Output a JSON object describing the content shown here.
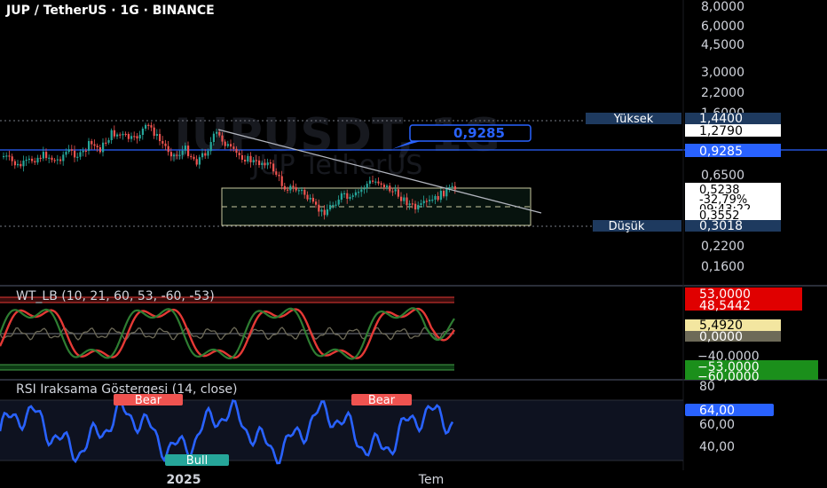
{
  "header": {
    "symbol_title": "JUP / TetherUS · 1G · BINANCE"
  },
  "watermark": {
    "ticker": "JUPUSDT, 1G",
    "name": "JUP TetherUS"
  },
  "colors": {
    "up": "#26a69a",
    "down": "#ef5350",
    "blue": "#2962ff",
    "rsi": "#2962ff",
    "bg": "#000000"
  },
  "price_pane": {
    "scale": "log",
    "axis_labels": [
      "8,0000",
      "6,0000",
      "4,5000",
      "3,0000",
      "2,2000",
      "1,6000",
      "0,6500",
      "0,2200",
      "0,1600"
    ],
    "axis_values": [
      8.0,
      6.0,
      4.5,
      3.0,
      2.2,
      1.6,
      0.65,
      0.22,
      0.16
    ],
    "high_label": "Yüksek",
    "high_value": "1,4400",
    "current_upper": "1,2790",
    "annotation_price": "0,9285",
    "price_close": "0,5238",
    "change_pct": "-32,79%",
    "countdown": "09:43:22",
    "price_lower": "0,3552",
    "low_label": "Düşük",
    "low_value": "0,3018"
  },
  "wt_pane": {
    "title": "WT_LB (10, 21, 60, 53, -60, -53)",
    "labels": {
      "ob1": "53,0000",
      "wt1": "48,5442",
      "diff": "5,4920",
      "zero": "0,0000",
      "neg40": "−40,0000",
      "os1": "−53,0000",
      "os2": "−60,0000"
    }
  },
  "rsi_pane": {
    "title": "RSI Iraksama Göstergesi (14, close)",
    "axis_labels": [
      "80",
      "60,00",
      "40,00"
    ],
    "value_label": "64,00",
    "bear_label": "Bear",
    "bull_label": "Bull"
  },
  "time_axis": {
    "labels": [
      "2025",
      "Tem"
    ]
  },
  "chart_data": [
    {
      "type": "candlestick",
      "title": "JUP / TetherUS · 1G · BINANCE",
      "ylim": [
        0.14,
        8.5
      ],
      "scale": "log",
      "summary": {
        "high": 1.44,
        "low": 0.3018,
        "last": 0.5238,
        "change_pct": -32.79
      }
    },
    {
      "type": "line",
      "title": "WT_LB (10, 21, 60, 53, -60, -53)",
      "levels": [
        53,
        60,
        -53,
        -60,
        0
      ],
      "last": {
        "wt1": 48.5442,
        "wt_diff": 5.492
      }
    },
    {
      "type": "line",
      "title": "RSI Iraksama Göstergesi (14, close)",
      "ylim": [
        30,
        80
      ],
      "last": 64.0,
      "labels": [
        "Bear",
        "Bull",
        "Bear"
      ]
    }
  ]
}
